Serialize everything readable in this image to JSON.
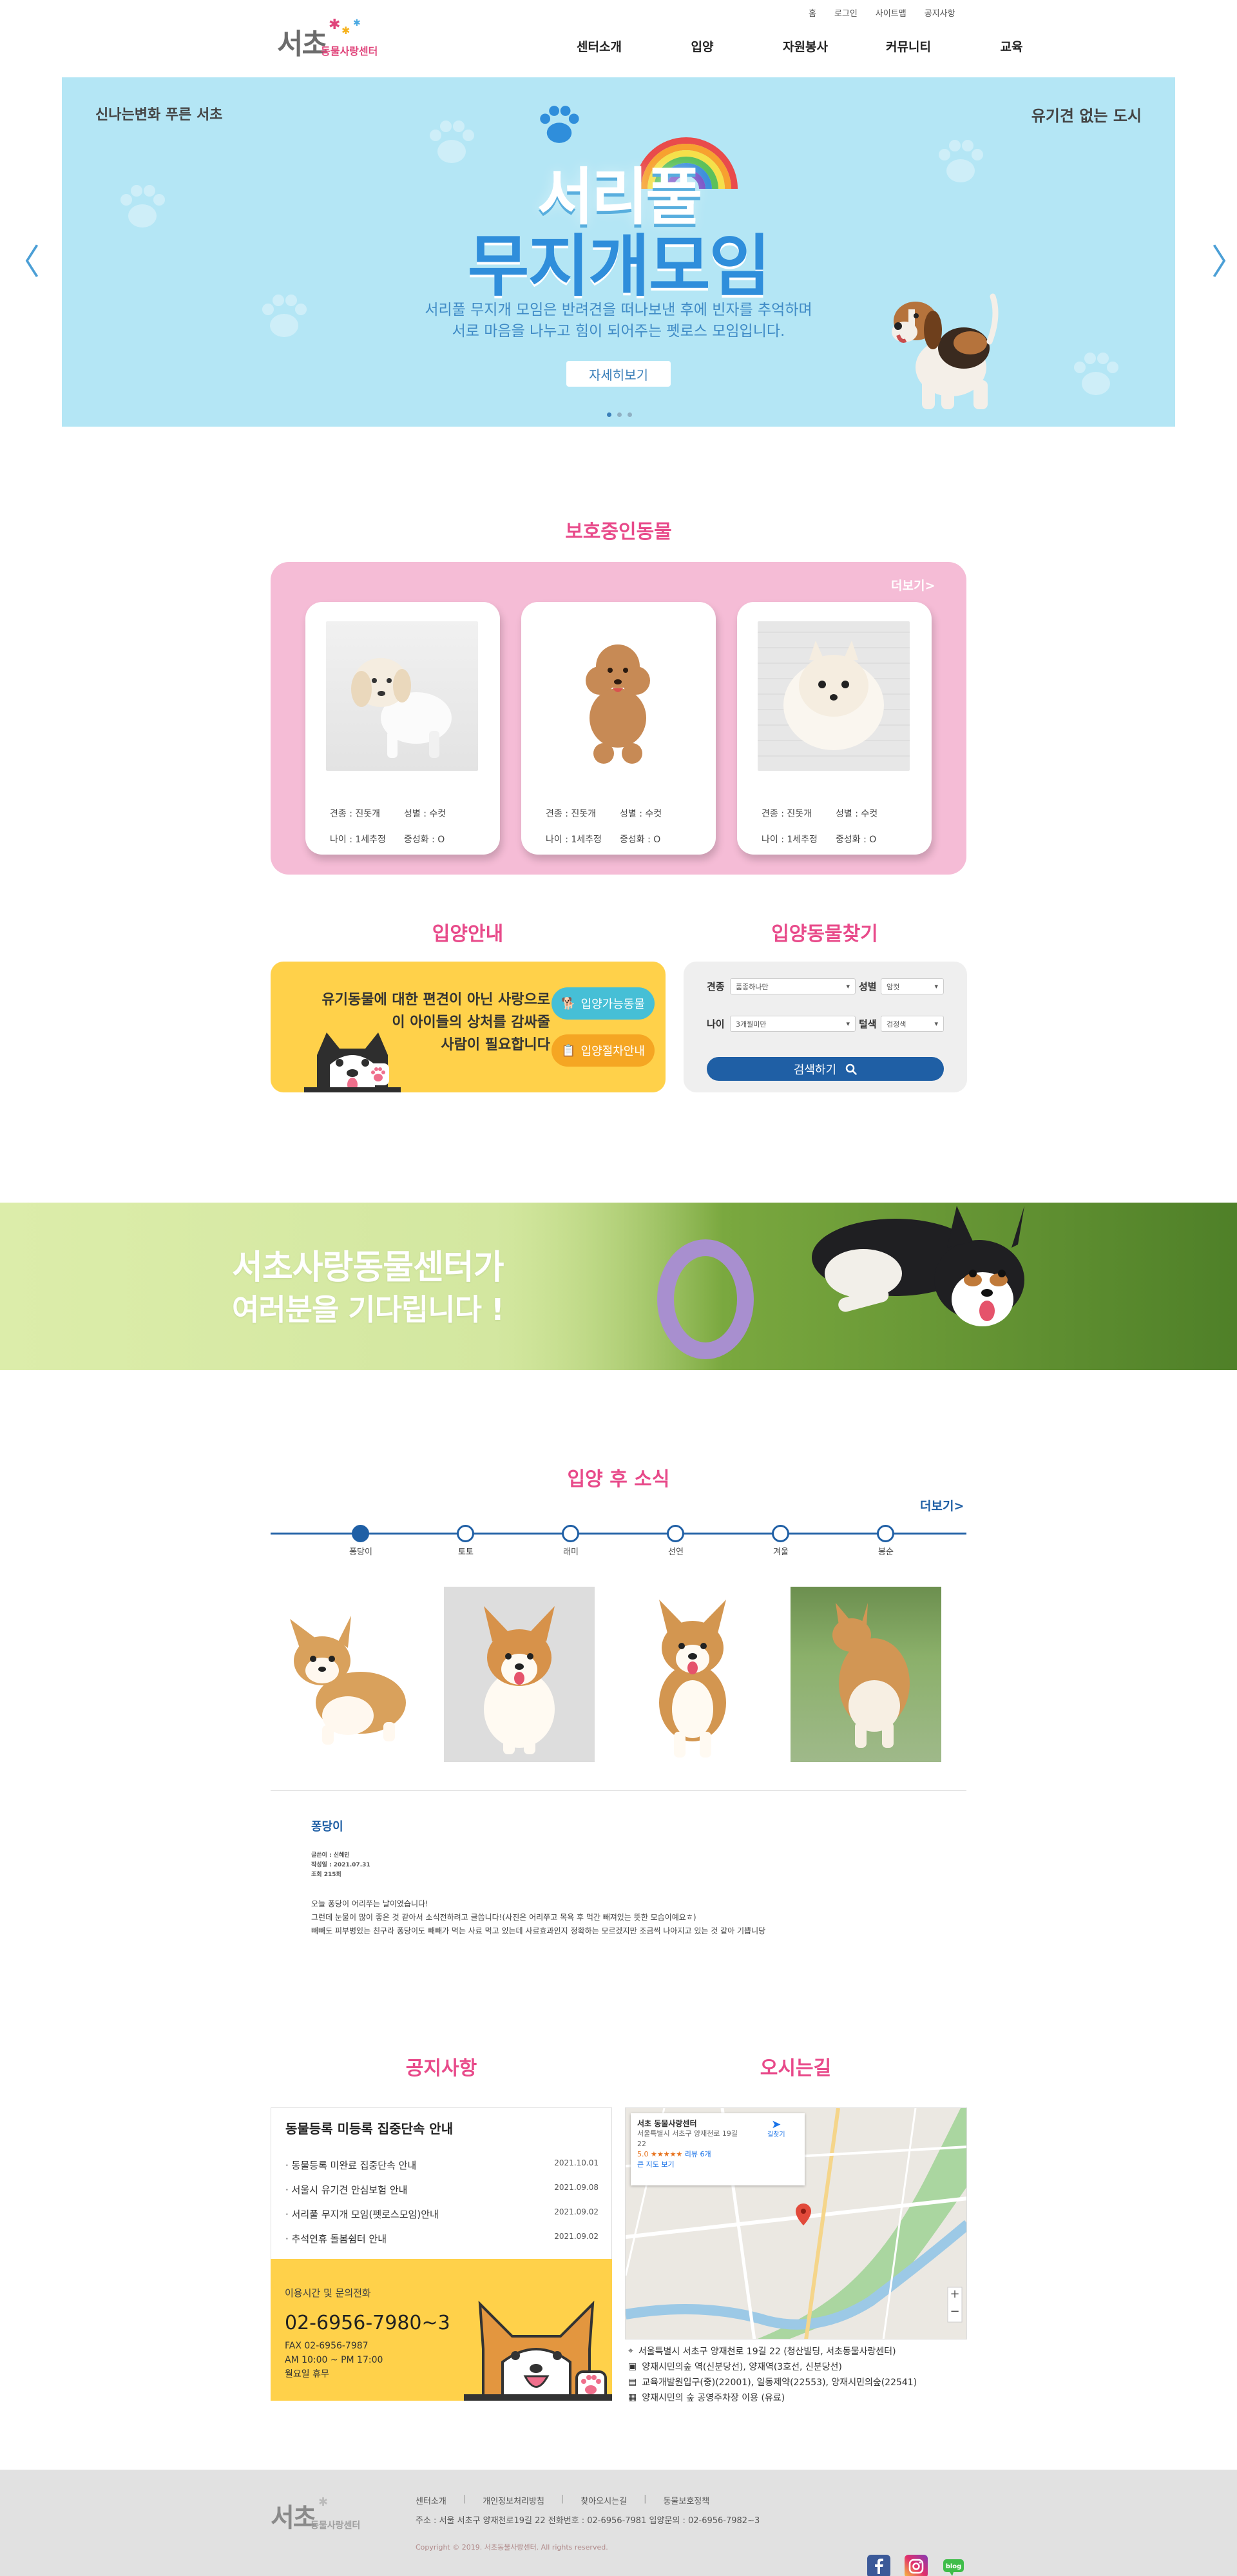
{
  "header": {
    "top_links": [
      "홈",
      "로그인",
      "사이트맵",
      "공지사항"
    ],
    "logo_main": "서초",
    "logo_sub": "동물사랑센터",
    "gnb": [
      "센터소개",
      "입양",
      "자원봉사",
      "커뮤니티",
      "교육"
    ]
  },
  "hero": {
    "left_logo": "신나는변화 푸른 서초",
    "right_logo": "유기견 없는 도시",
    "title_line1": "서리풀",
    "title_line2": "무지개모임",
    "desc_line1": "서리풀 무지개 모임은 반려견을 떠나보낸 후에 빈자를 추억하며",
    "desc_line2": "서로 마음을 나누고 힘이 되어주는 펫로스 모임입니다.",
    "button": "자세히보기",
    "prev_arrow": "〈",
    "next_arrow": "〉"
  },
  "protected": {
    "title": "보호중인동물",
    "more": "더보기>",
    "cards": [
      {
        "breed": "견종 : 진돗개",
        "sex": "성별 : 수컷",
        "age": "나이 : 1세추정",
        "neuter": "중성화 : O"
      },
      {
        "breed": "견종 : 진돗개",
        "sex": "성별 : 수컷",
        "age": "나이 : 1세추정",
        "neuter": "중성화 : O"
      },
      {
        "breed": "견종 : 진돗개",
        "sex": "성별 : 수컷",
        "age": "나이 : 1세추정",
        "neuter": "중성화 : O"
      }
    ]
  },
  "adopt_guide": {
    "title": "입양안내",
    "text_line1": "유기동물에 대한 편견이 아닌 사랑으로",
    "text_line2": "이 아이들의 상처를 감싸줄",
    "text_line3": "사람이 필요합니다",
    "btn_available": "입양가능동물",
    "btn_procedure": "입양절차안내"
  },
  "adopt_search": {
    "title": "입양동물찾기",
    "breed_label": "견종",
    "breed_value": "품종하나만",
    "sex_label": "성별",
    "sex_value": "암컷",
    "age_label": "나이",
    "age_value": "3개월미만",
    "weight_label": "털색",
    "weight_value": "검정색",
    "search_btn": "검색하기"
  },
  "banner": {
    "line1": "서초사랑동물센터가",
    "line2": "여러분을 기다립니다 !"
  },
  "news": {
    "title": "입양 후 소식",
    "more": "더보기>",
    "timeline": [
      "퐁당이",
      "토토",
      "래미",
      "선연",
      "겨울",
      "봉순"
    ],
    "post_title": "퐁당이",
    "meta_author": "글쓴이 : 신혜민",
    "meta_date": "작성일 : 2021.07.31",
    "meta_views": "조회 215회",
    "body_line1": "오늘 퐁당이 어리쭈는 날이였습니다!",
    "body_line2": "그런데 눈물이 많이 좋은 것 같아서 소식전하려고 글씁니다!(사진은 어리쭈고 목욕 후 먹간 빼져있는 뜻한 모습이예요ㅎ)",
    "body_line3": "빼빼도 피부병있는 친구라 퐁당이도 빼빼가 먹는 사료 먹고 있는데 사료효과인지 정확하는 모르겠지만 조금씩 나아지고 있는 것 같아 기쁩니당"
  },
  "notice": {
    "title": "공지사항",
    "box_title": "동물등록 미등록 집중단속 안내",
    "items": [
      {
        "text": "동물등록 미완료 집중단속 안내",
        "date": "2021.10.01"
      },
      {
        "text": "서울시 유기견 안심보험 안내",
        "date": "2021.09.08"
      },
      {
        "text": "서리풀 무지개 모임(펫로스모임)안내",
        "date": "2021.09.02"
      },
      {
        "text": "추석연휴 돌봄쉼터 안내",
        "date": "2021.09.02"
      }
    ],
    "contact_label": "이용시간 및 문의전화",
    "phone": "02-6956-7980~3",
    "fax": "FAX 02-6956-7987",
    "hours": "AM 10:00 ~ PM 17:00",
    "holiday": "월요일 휴무"
  },
  "directions": {
    "title": "오시는길",
    "map_place": "서초 동물사랑센터",
    "map_addr": "서울특별시 서초구 양재천로 19길 22",
    "map_rating": "5.0 ★★★★★",
    "map_reviews": "리뷰 6개",
    "map_larger": "큰 지도 보기",
    "map_route": "길찾기",
    "addr1": "서울특별시 서초구 양재천로 19길 22 (청산빌딩, 서초동물사랑센터)",
    "addr2": "양재시민의숲 역(신분당선), 양재역(3호선, 신분당선)",
    "addr3": "교육개발원입구(중)(22001), 일동제약(22553), 양재시민의숲(22541)",
    "addr4": "양재시민의 숲 공영주차장 이용 (유료)"
  },
  "footer": {
    "nav": [
      "센터소개",
      "개인정보처리방침",
      "찾아오시는길",
      "동물보호정책"
    ],
    "address": "주소 : 서울 서초구 양재천로19길 22 전화번호 : 02-6956-7981 입양문의 : 02-6956-7982~3",
    "copyright": "Copyright © 2019. 서초동물사랑센터. All rights reserved.",
    "logo_main": "서초",
    "logo_sub": "동물사랑센터"
  },
  "colors": {
    "accent_pink": "#e84a8a",
    "accent_blue": "#1f5fa5",
    "hero_bg": "#b4e6f5",
    "card_bg": "#f5bcd6",
    "yellow": "#ffd14a"
  }
}
